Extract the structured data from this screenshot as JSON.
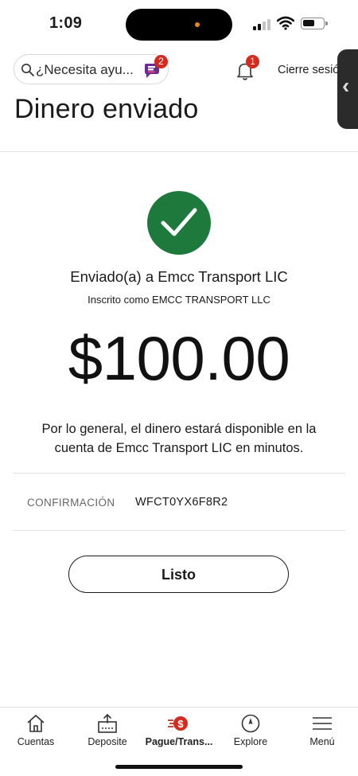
{
  "status_bar": {
    "time": "1:09"
  },
  "header": {
    "search_placeholder": "¿Necesita ayu...",
    "assistant_badge": "2",
    "notification_badge": "1",
    "logout_label": "Cierre sesión"
  },
  "page": {
    "title": "Dinero enviado"
  },
  "confirmation": {
    "sent_to": "Enviado(a) a Emcc Transport LIC",
    "enrolled_as": "Inscrito como EMCC TRANSPORT LLC",
    "amount": "$100.00",
    "availability_note": "Por lo general, el dinero estará disponible en la cuenta de Emcc Transport LIC en minutos.",
    "confirmation_label": "CONFIRMACIÓN",
    "confirmation_number": "WFCT0YX6F8R2",
    "done_label": "Listo"
  },
  "bottom_nav": {
    "items": [
      {
        "label": "Cuentas",
        "icon": "home-icon"
      },
      {
        "label": "Deposite",
        "icon": "deposit-icon"
      },
      {
        "label": "Pague/Trans...",
        "icon": "pay-transfer-icon",
        "active": true
      },
      {
        "label": "Explore",
        "icon": "compass-icon"
      },
      {
        "label": "Menú",
        "icon": "menu-icon"
      }
    ]
  },
  "colors": {
    "success_green": "#1d7a3c",
    "badge_red": "#d42a1f",
    "text_dark": "#1a1a1a",
    "label_gray": "#666666"
  }
}
